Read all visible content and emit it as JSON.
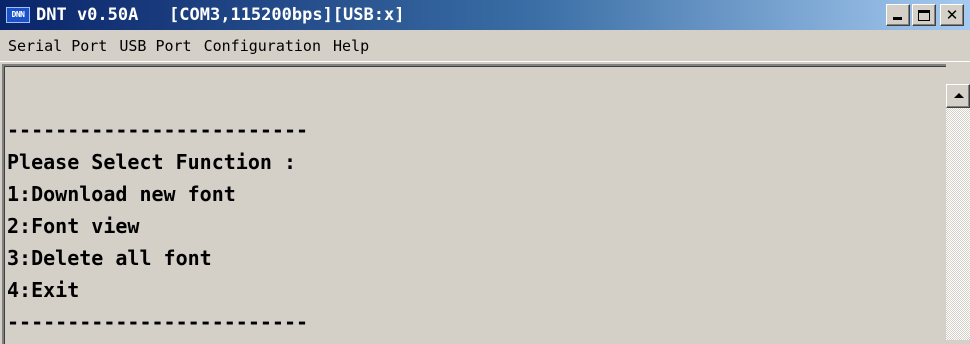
{
  "window": {
    "icon_text": "DNN",
    "title": "DNT v0.50A   [COM3,115200bps][USB:x]"
  },
  "menu": {
    "items": [
      {
        "label": "Serial Port"
      },
      {
        "label": "USB Port"
      },
      {
        "label": "Configuration"
      },
      {
        "label": "Help"
      }
    ]
  },
  "terminal": {
    "lines": [
      "-------------------------",
      "Please Select Function :",
      "1:Download new font",
      "2:Font view",
      "3:Delete all font",
      "4:Exit",
      "-------------------------"
    ]
  },
  "icons": {
    "app": "dnn-app-icon",
    "minimize": "minimize-icon",
    "maximize": "maximize-icon",
    "close": "close-icon",
    "scroll_up": "up-arrow-icon"
  },
  "colors": {
    "titlebar_start": "#0a246a",
    "titlebar_end": "#a6caf0",
    "window_bg": "#d4d0c8",
    "text": "#000000"
  }
}
